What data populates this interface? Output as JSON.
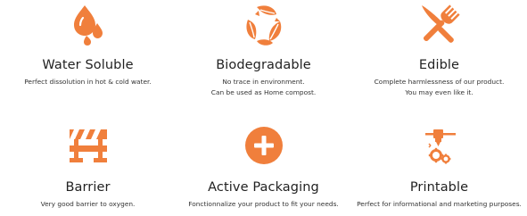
{
  "accent_color": "#f07f3c",
  "features": [
    {
      "icon": "water-drops-icon",
      "title": "Water Soluble",
      "description": [
        "Perfect dissolution in hot & cold water."
      ]
    },
    {
      "icon": "leaves-recycle-icon",
      "title": "Biodegradable",
      "description": [
        "No trace in environment.",
        "Can be used as Home compost."
      ]
    },
    {
      "icon": "fork-knife-icon",
      "title": "Edible",
      "description": [
        "Complete harmlessness of our product.",
        "You may even like it."
      ]
    },
    {
      "icon": "barrier-icon",
      "title": "Barrier",
      "description": [
        "Very good barrier to oxygen."
      ]
    },
    {
      "icon": "plus-circle-icon",
      "title": "Active Packaging",
      "description": [
        "Fonctionnalize your product to fit your needs."
      ]
    },
    {
      "icon": "3d-printer-icon",
      "title": "Printable",
      "description": [
        "Perfect for informational and marketing purposes."
      ]
    }
  ]
}
